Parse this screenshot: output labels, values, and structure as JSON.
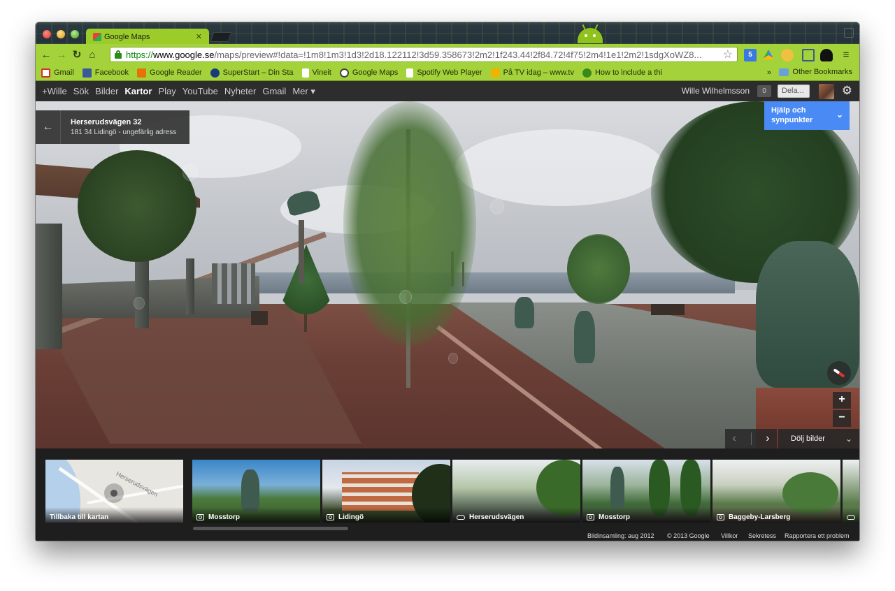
{
  "browser": {
    "tab_title": "Google Maps",
    "url": {
      "scheme": "https://",
      "host": "www.google.se",
      "path": "/maps/preview#!data=!1m8!1m3!1d3!2d18.122112!3d59.358673!2m2!1f243.44!2f84.72!4f75!2m4!1e1!2m2!1sdgXoWZ8..."
    },
    "extension_badge": "5"
  },
  "bookmarks": [
    {
      "label": "Gmail",
      "color": "#d93025"
    },
    {
      "label": "Facebook",
      "color": "#3b5998"
    },
    {
      "label": "Google Reader",
      "color": "#e8710a"
    },
    {
      "label": "SuperStart – Din Sta",
      "color": "#1a3a7a"
    },
    {
      "label": "Vineit",
      "color": "#ffffff"
    },
    {
      "label": "Google Maps",
      "color": "#ffffff"
    },
    {
      "label": "Spotify Web Player",
      "color": "#ffffff"
    },
    {
      "label": "På TV idag – www.tv",
      "color": "#f0b400"
    },
    {
      "label": "How to include a thi",
      "color": "#3a8a1a"
    }
  ],
  "bookmarks_more": "»",
  "bookmarks_other": "Other Bookmarks",
  "gbar": {
    "links": [
      "+Wille",
      "Sök",
      "Bilder",
      "Kartor",
      "Play",
      "YouTube",
      "Nyheter",
      "Gmail",
      "Mer ▾"
    ],
    "active": "Kartor",
    "user_name": "Wille Wilhelmsson",
    "notifications": "0",
    "share_label": "Dela..."
  },
  "address": {
    "title": "Herserudsvägen 32",
    "subtitle": "181 34 Lidingö - ungefärlig adress"
  },
  "help_button": "Hjälp och synpunkter",
  "hide_images": "Dölj bilder",
  "filmstrip": [
    {
      "type": "map",
      "label": "Tillbaka till kartan",
      "street_label": "Herserudsvägen"
    },
    {
      "type": "photo",
      "label": "Mosstorp"
    },
    {
      "type": "photo",
      "label": "Lidingö"
    },
    {
      "type": "pano",
      "label": "Herserudsvägen"
    },
    {
      "type": "photo",
      "label": "Mosstorp"
    },
    {
      "type": "photo",
      "label": "Baggeby-Larsberg"
    }
  ],
  "footer": {
    "capture": "Bildinsamling: aug 2012",
    "copyright": "© 2013 Google",
    "terms": "Villkor",
    "privacy": "Sekretess",
    "report": "Rapportera ett problem"
  },
  "colors": {
    "theme_green": "#a4d23a",
    "help_blue": "#4a8af4",
    "gbar_bg": "#2d2d2d"
  }
}
